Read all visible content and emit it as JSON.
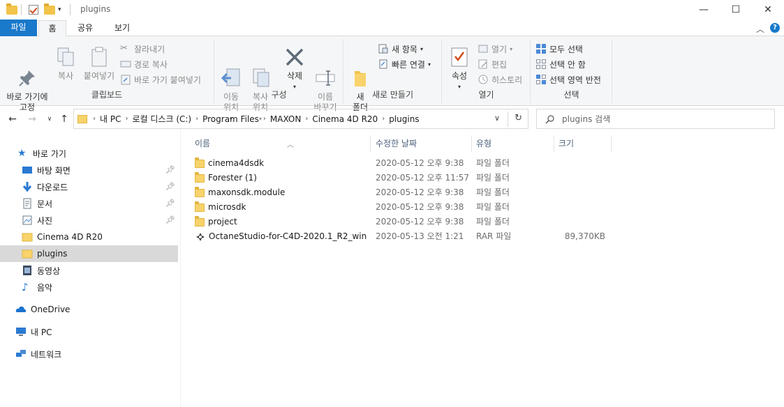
{
  "title": "plugins",
  "window_controls": {
    "minimize": "—",
    "maximize": "☐",
    "close": "✕"
  },
  "ribbon_tabs": [
    "파일",
    "홈",
    "공유",
    "보기"
  ],
  "ribbon": {
    "clipboard": {
      "label": "클립보드",
      "pin_quick": "바로 가기에\n고정",
      "copy": "복사",
      "paste": "붙여넣기",
      "cut": "잘라내기",
      "copy_path": "경로 복사",
      "paste_shortcut": "바로 가기 붙여넣기"
    },
    "organize": {
      "label": "구성",
      "move_to": "이동\n위치",
      "copy_to": "복사\n위치",
      "delete": "삭제",
      "rename": "이름\n바꾸기"
    },
    "new": {
      "label": "새로 만들기",
      "new_folder": "새\n폴더",
      "new_item": "새 항목",
      "easy_access": "빠른 연결"
    },
    "open": {
      "label": "열기",
      "properties": "속성",
      "open": "열기",
      "edit": "편집",
      "history": "히스토리"
    },
    "select": {
      "label": "선택",
      "select_all": "모두 선택",
      "select_none": "선택 안 함",
      "invert": "선택 영역 반전"
    }
  },
  "address": {
    "crumbs": [
      "내 PC",
      "로컬 디스크 (C:)",
      "Program Files",
      "MAXON",
      "Cinema 4D R20",
      "plugins"
    ],
    "search_placeholder": "plugins 검색"
  },
  "nav": {
    "quick_access": "바로 가기",
    "items": [
      {
        "label": "바탕 화면",
        "pinned": true
      },
      {
        "label": "다운로드",
        "pinned": true
      },
      {
        "label": "문서",
        "pinned": true
      },
      {
        "label": "사진",
        "pinned": true
      },
      {
        "label": "Cinema 4D R20",
        "pinned": false
      },
      {
        "label": "plugins",
        "pinned": false
      },
      {
        "label": "동영상",
        "pinned": false
      },
      {
        "label": "음악",
        "pinned": false
      }
    ],
    "onedrive": "OneDrive",
    "this_pc": "내 PC",
    "network": "네트워크"
  },
  "columns": {
    "name": "이름",
    "date": "수정한 날짜",
    "type": "유형",
    "size": "크기"
  },
  "files": [
    {
      "name": "cinema4dsdk",
      "date": "2020-05-12 오후 9:38",
      "type": "파일 폴더",
      "size": "",
      "kind": "folder"
    },
    {
      "name": "Forester (1)",
      "date": "2020-05-12 오후 11:57",
      "type": "파일 폴더",
      "size": "",
      "kind": "folder"
    },
    {
      "name": "maxonsdk.module",
      "date": "2020-05-12 오후 9:38",
      "type": "파일 폴더",
      "size": "",
      "kind": "folder"
    },
    {
      "name": "microsdk",
      "date": "2020-05-12 오후 9:38",
      "type": "파일 폴더",
      "size": "",
      "kind": "folder"
    },
    {
      "name": "project",
      "date": "2020-05-12 오후 9:38",
      "type": "파일 폴더",
      "size": "",
      "kind": "folder"
    },
    {
      "name": "OctaneStudio-for-C4D-2020.1_R2_win",
      "date": "2020-05-13 오전 1:21",
      "type": "RAR 파일",
      "size": "89,370KB",
      "kind": "rar"
    }
  ],
  "colors": {
    "accent": "#1979ca",
    "folder": "#f8d36b",
    "selected_nav": "#d9d9d9"
  }
}
